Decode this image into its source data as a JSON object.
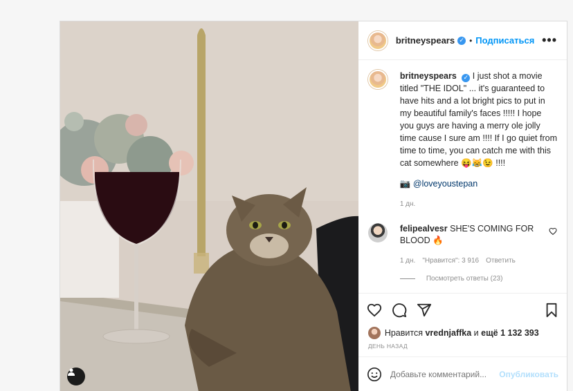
{
  "post": {
    "author": "britneyspears",
    "follow_label": "Подписаться",
    "more_label": "•••",
    "caption_user": "britneyspears",
    "caption_text": "I just shot a movie titled \"THE IDOL\" ... it's guaranteed to have hits and a lot bright pics to put in my beautiful family's faces !!!!! I hope you guys are having a merry ole jolly time cause I sure am !!!! If I go quiet from time to time, you can catch me with this cat somewhere 😝😹😉 !!!!",
    "mention_icon": "📷",
    "mention": "@loveyoustepan",
    "posted_ago": "1 дн.",
    "comment": {
      "user": "felipealvesr",
      "text": "SHE'S COMING FOR BLOOD 🔥",
      "ago": "1 дн.",
      "likes": "\"Нравится\": 3 916",
      "reply_label": "Ответить",
      "view_replies": "Посмотреть ответы (23)"
    },
    "likes_prefix": "Нравится",
    "likes_user": "vrednjaffka",
    "likes_mid": "и",
    "likes_count": "ещё 1 132 393",
    "date_label": "ДЕНЬ НАЗАД",
    "comment_placeholder": "Добавьте комментарий...",
    "publish_label": "Опубликовать"
  },
  "icons": {
    "verified": "verified-badge-icon",
    "heart": "heart-icon",
    "comment": "comment-icon",
    "share": "share-icon",
    "bookmark": "bookmark-icon",
    "emoji": "emoji-icon",
    "tag": "user-tag-icon"
  },
  "colors": {
    "link": "#0095f6",
    "verified": "#3897f0",
    "muted": "#8e8e8e"
  }
}
